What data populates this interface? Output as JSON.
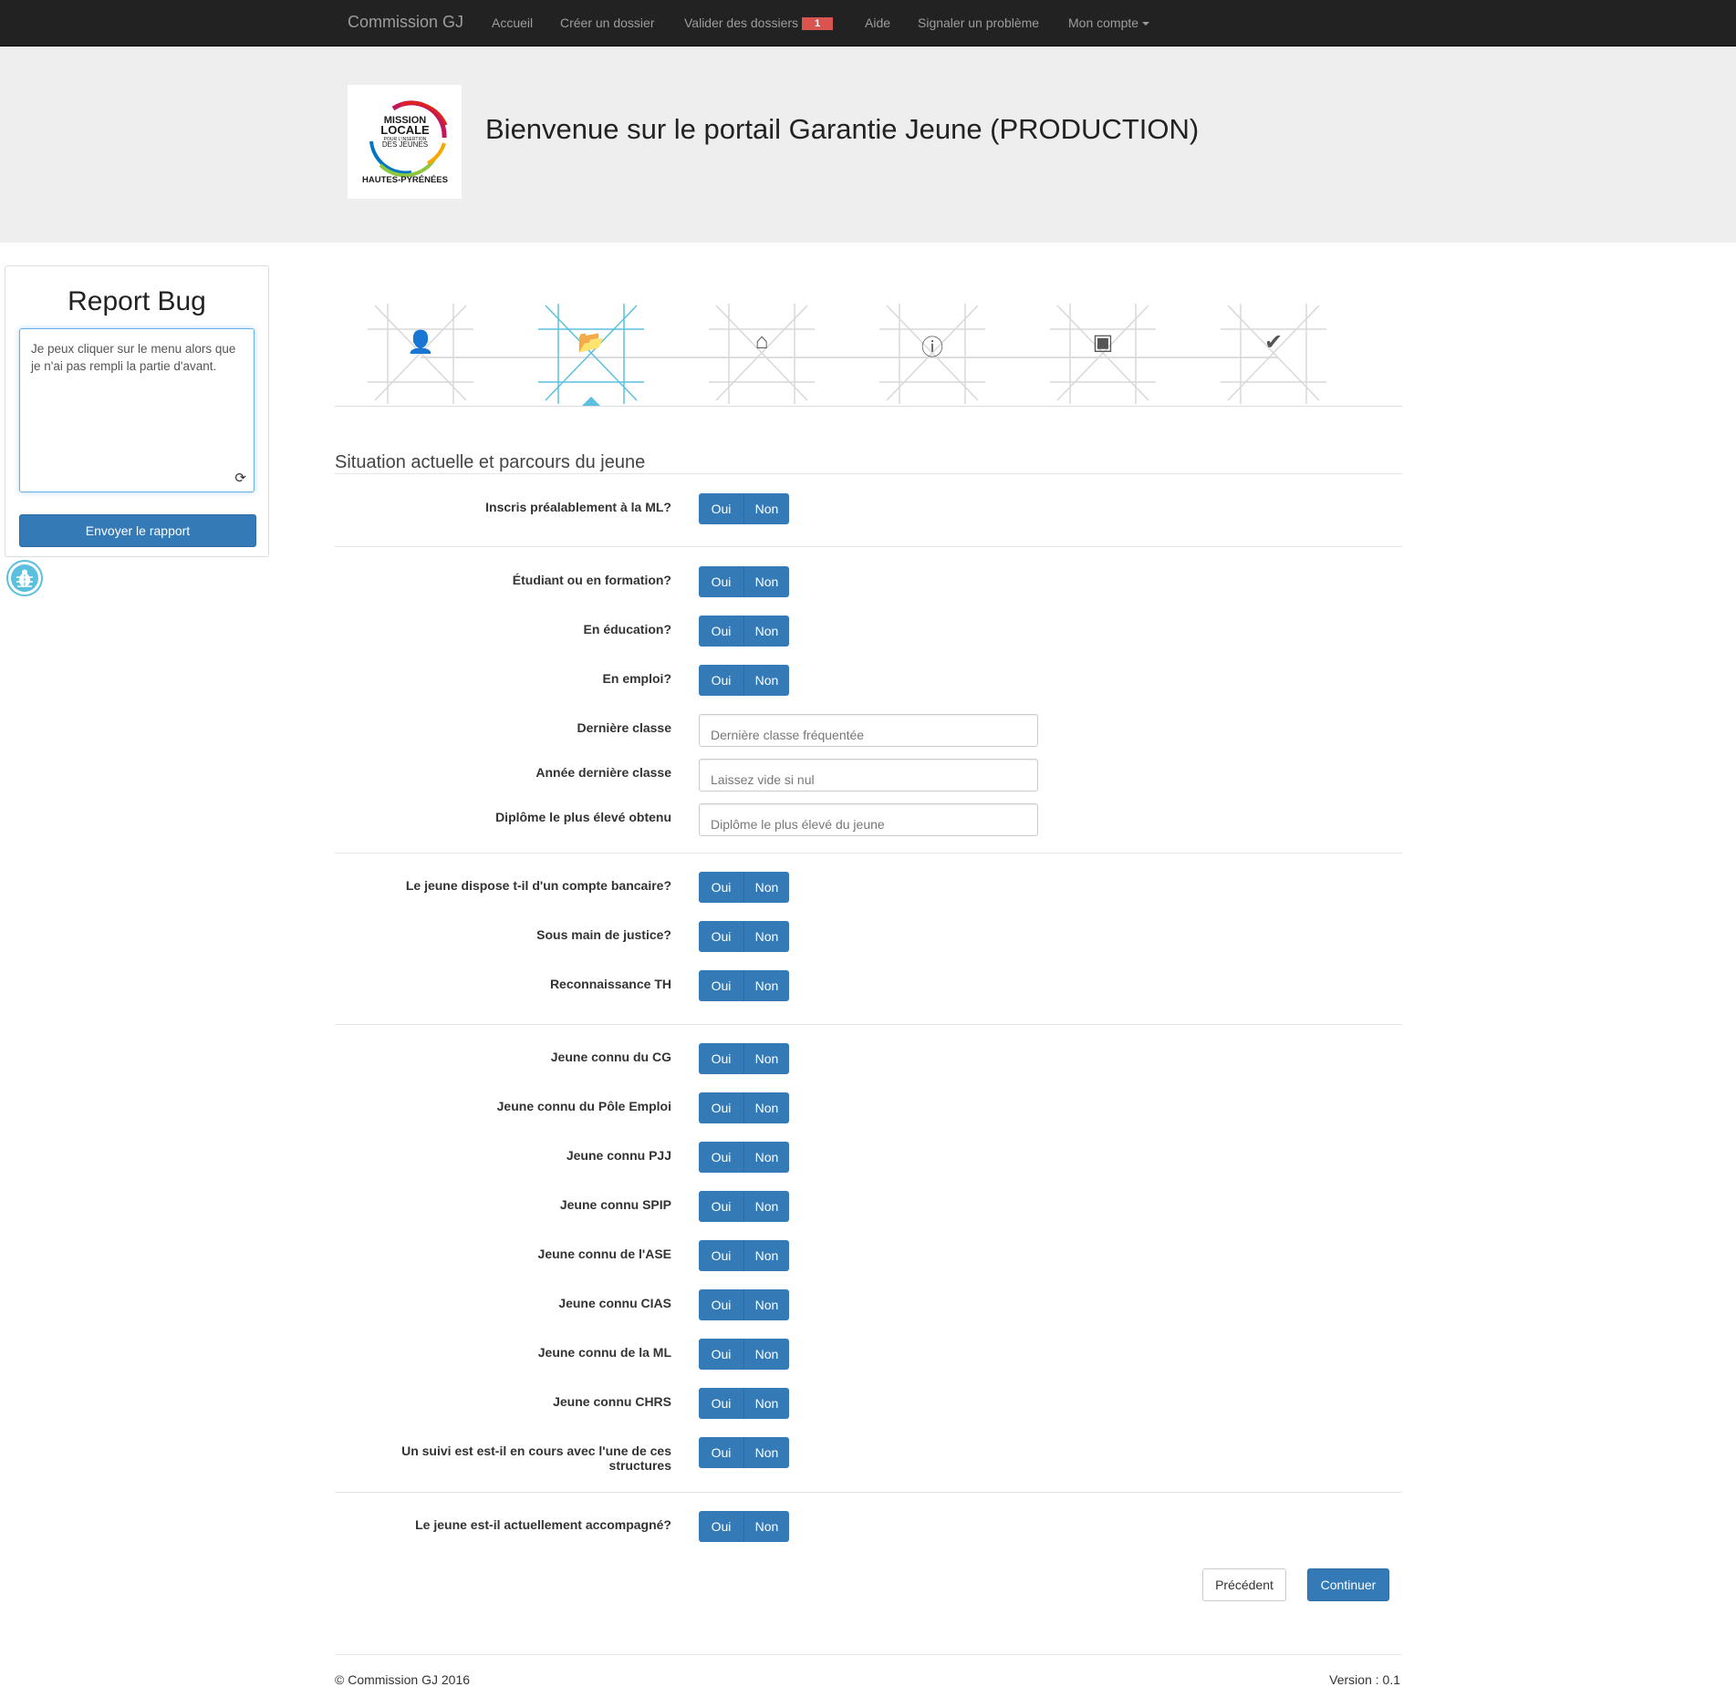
{
  "navbar": {
    "brand": "Commission GJ",
    "items": [
      {
        "label": "Accueil"
      },
      {
        "label": "Créer un dossier"
      },
      {
        "label": "Valider des dossiers",
        "badge": "1"
      },
      {
        "label": "Aide"
      },
      {
        "label": "Signaler un problème"
      },
      {
        "label": "Mon compte"
      }
    ]
  },
  "header": {
    "logo_text": "MISSION LOCALE POUR L'INSERTION DES JEUNES HAUTES-PYRÉNÉES",
    "title": "Bienvenue sur le portail Garantie Jeune (PRODUCTION)"
  },
  "bug_report": {
    "title": "Report Bug",
    "text": "Je peux cliquer sur le menu alors que je n'ai pas rempli la partie d'avant.",
    "send_label": "Envoyer le rapport"
  },
  "stepper": {
    "steps": [
      {
        "icon": "user-icon",
        "glyph": "👤",
        "active": false
      },
      {
        "icon": "folder-open-icon",
        "glyph": "📂",
        "active": true
      },
      {
        "icon": "home-icon",
        "glyph": "⌂",
        "active": false
      },
      {
        "icon": "info-sign-icon",
        "glyph": "ⓘ",
        "active": false
      },
      {
        "icon": "picture-icon",
        "glyph": "▣",
        "active": false
      },
      {
        "icon": "ok-icon",
        "glyph": "✔",
        "active": false
      }
    ]
  },
  "form": {
    "section_title": "Situation actuelle et parcours du jeune",
    "yes_label": "Oui",
    "no_label": "Non",
    "questions": {
      "inscrit_ml": "Inscris préalablement à la ML?",
      "etudiant": "Étudiant ou en formation?",
      "education": "En éducation?",
      "emploi": "En emploi?",
      "compte_bancaire": "Le jeune dispose t-il d'un compte bancaire?",
      "justice": "Sous main de justice?",
      "th": "Reconnaissance TH",
      "cg": "Jeune connu du CG",
      "pole_emploi": "Jeune connu du Pôle Emploi",
      "pjj": "Jeune connu PJJ",
      "spip": "Jeune connu SPIP",
      "ase": "Jeune connu de l'ASE",
      "cias": "Jeune connu CIAS",
      "ml": "Jeune connu de la ML",
      "chrs": "Jeune connu CHRS",
      "suivi": "Un suivi est est-il en cours avec l'une de ces structures",
      "accompagne": "Le jeune est-il actuellement accompagné?"
    },
    "fields": {
      "derniere_classe": {
        "label": "Dernière classe",
        "placeholder": "Dernière classe fréquentée",
        "value": ""
      },
      "annee_derniere_classe": {
        "label": "Année dernière classe",
        "placeholder": "Laissez vide si nul",
        "value": ""
      },
      "diplome": {
        "label": "Diplôme le plus élevé obtenu",
        "placeholder": "Diplôme le plus élevé du jeune",
        "value": ""
      }
    },
    "prev_label": "Précédent",
    "next_label": "Continuer"
  },
  "footer": {
    "copyright": "© Commission GJ 2016",
    "version": "Version : 0.1"
  },
  "colors": {
    "primary": "#337ab7",
    "navbar": "#222222",
    "accent": "#5bc0de",
    "badge": "#d9534f",
    "jumbotron": "#eeeeee"
  }
}
